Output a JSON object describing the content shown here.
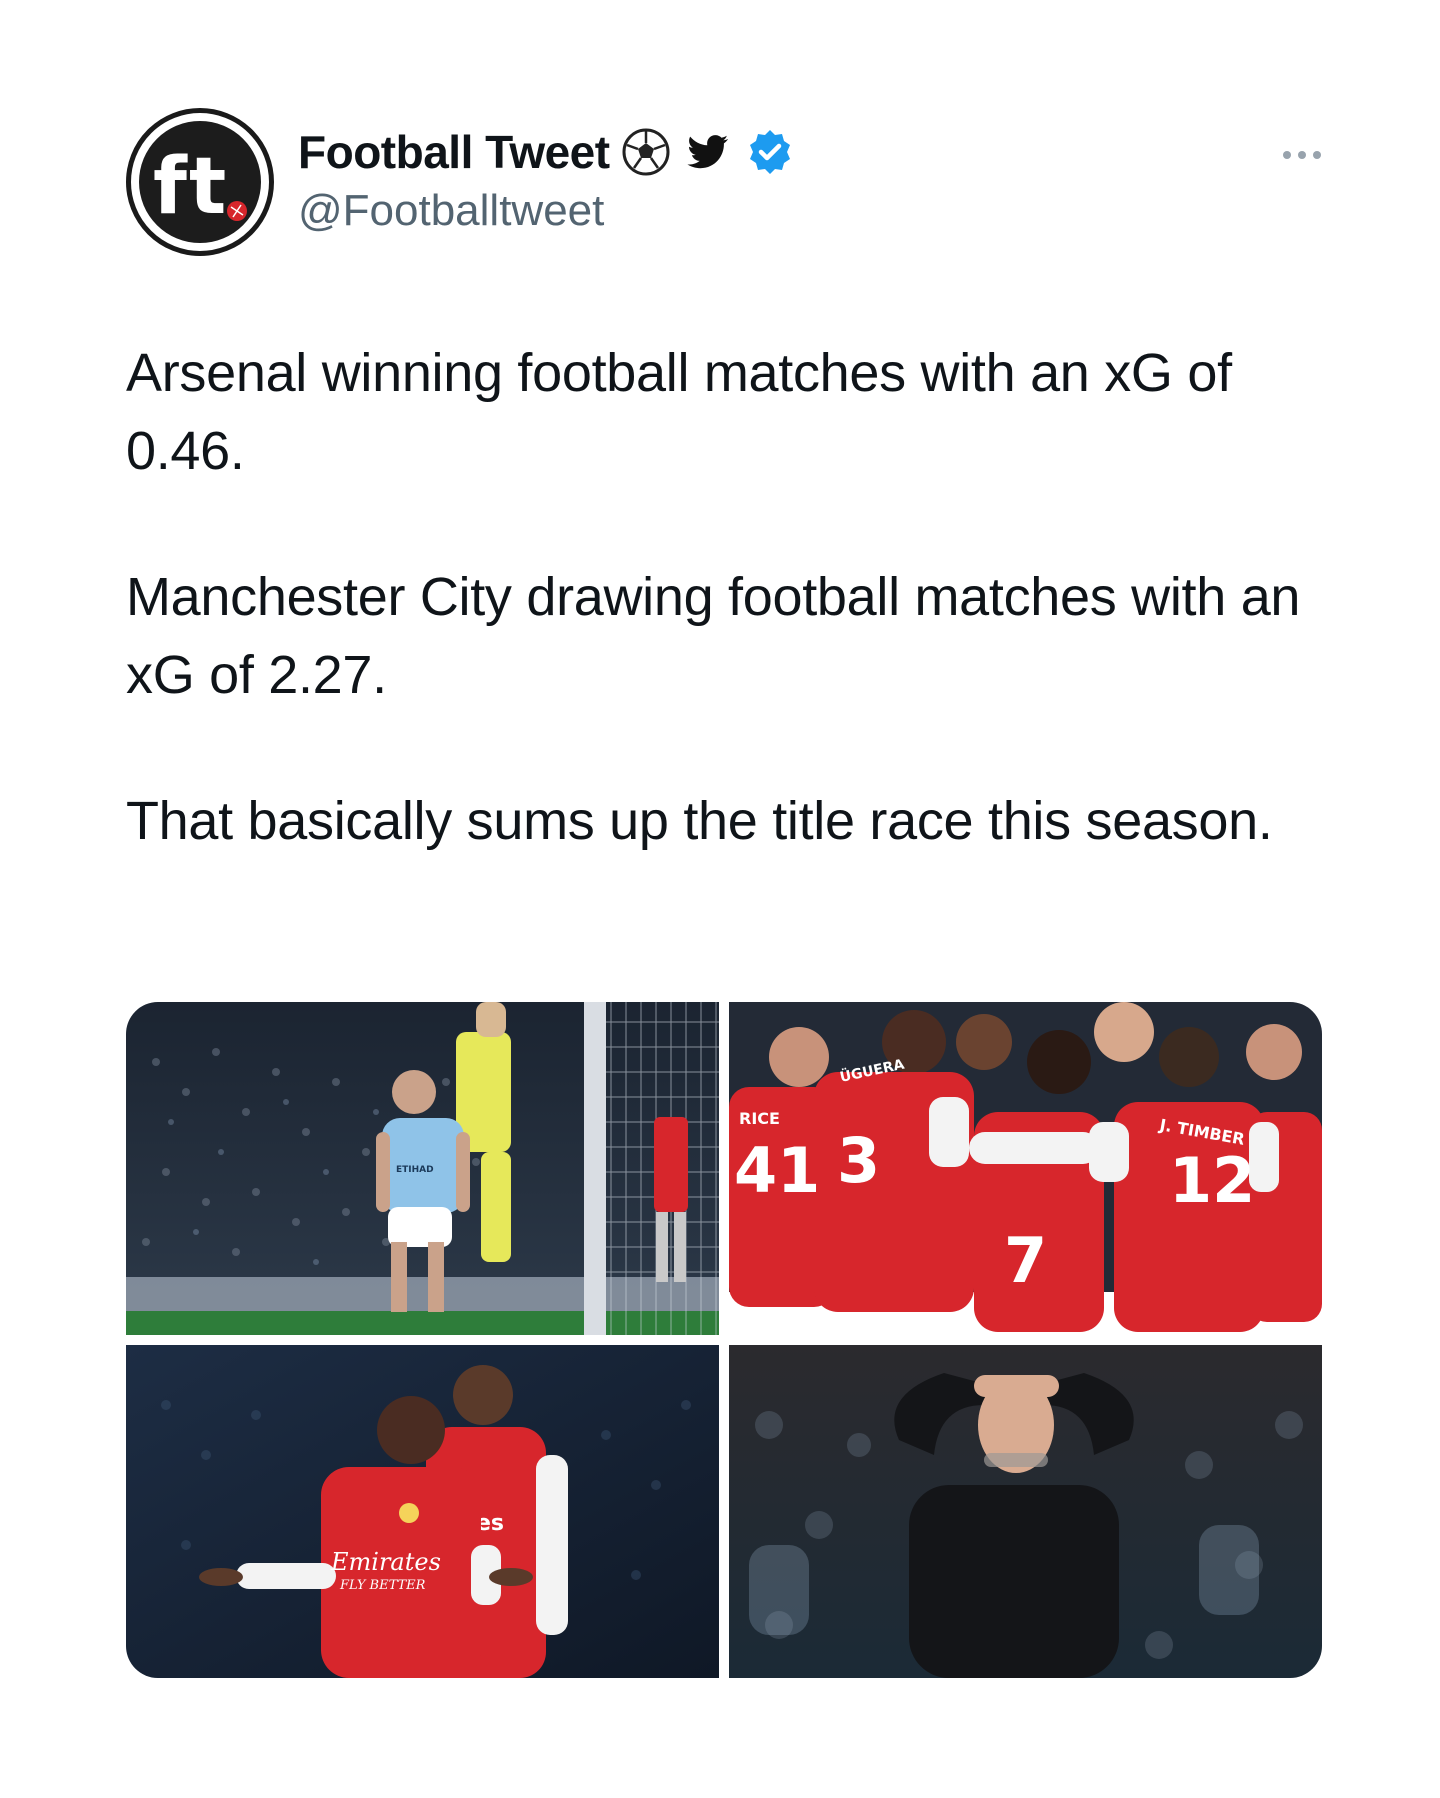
{
  "author": {
    "display_name": "Football Tweet",
    "handle": "@Footballtweet",
    "avatar_icon": "ft-logo-icon",
    "name_icons": [
      "soccer-ball-icon",
      "twitter-bird-icon",
      "verified-badge-icon"
    ],
    "verified_color": "#1d9bf0"
  },
  "menu": {
    "icon": "more-options-icon"
  },
  "tweet": {
    "paragraphs": [
      "Arsenal winning football matches with an xG of 0.46.",
      "Manchester City drawing football matches with an xG of 2.27.",
      "That basically sums up the title race this season."
    ]
  },
  "media": {
    "photos": [
      {
        "name": "city-player-dejected-photo",
        "jersey_text": "ETIHAD"
      },
      {
        "name": "arsenal-players-celebrating-photo",
        "jersey_text": [
          "RICE",
          "41",
          "3",
          "12",
          "J. TIMBER",
          "ÜGUERA"
        ]
      },
      {
        "name": "arsenal-players-shrugging-photo",
        "jersey_text": [
          "Emirates",
          "FLY BETTER",
          "es"
        ]
      },
      {
        "name": "manager-hands-on-head-photo"
      }
    ]
  },
  "colors": {
    "arsenal_red": "#d7262c",
    "city_blue": "#8fc3e8",
    "text": "#0f1419",
    "secondary_text": "#536471"
  }
}
